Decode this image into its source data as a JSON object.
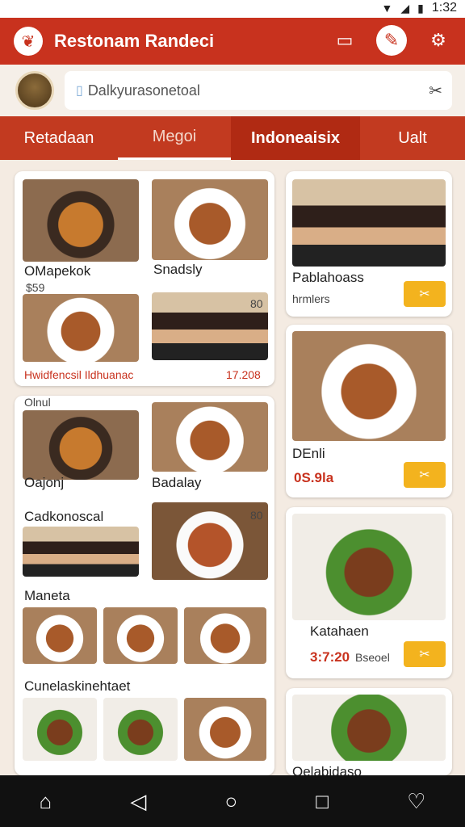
{
  "status": {
    "time": "1:32"
  },
  "appbar": {
    "title": "Restonam Randeci"
  },
  "search": {
    "placeholder": "Dalkyurasonetoal"
  },
  "tabs": [
    "Retadaan",
    "Megoi",
    "Indoneaisix",
    "Ualt"
  ],
  "cards": {
    "c1": {
      "title1": "OMapekok",
      "price1": "$59",
      "title2": "Snadsly",
      "badge": "80",
      "footer": "Hwidfencsil Ildhuanac",
      "footer_price": "17.208"
    },
    "c2": {
      "top": "Olnul",
      "title1": "Oajonj",
      "sub1": "Cadkonoscal",
      "title2": "Badalay",
      "badge": "80",
      "sec1": "Maneta",
      "sec2": "Cunelaskinehtaet"
    },
    "r1": {
      "title": "Pablahoass",
      "sub": "hrmlers"
    },
    "r2": {
      "title": "DEnli",
      "price": "0S.9la"
    },
    "r3": {
      "title": "Katahaen",
      "price": "3:7:20",
      "sub": "Bseoel"
    },
    "r4": {
      "title": "Oelabidaso"
    }
  }
}
